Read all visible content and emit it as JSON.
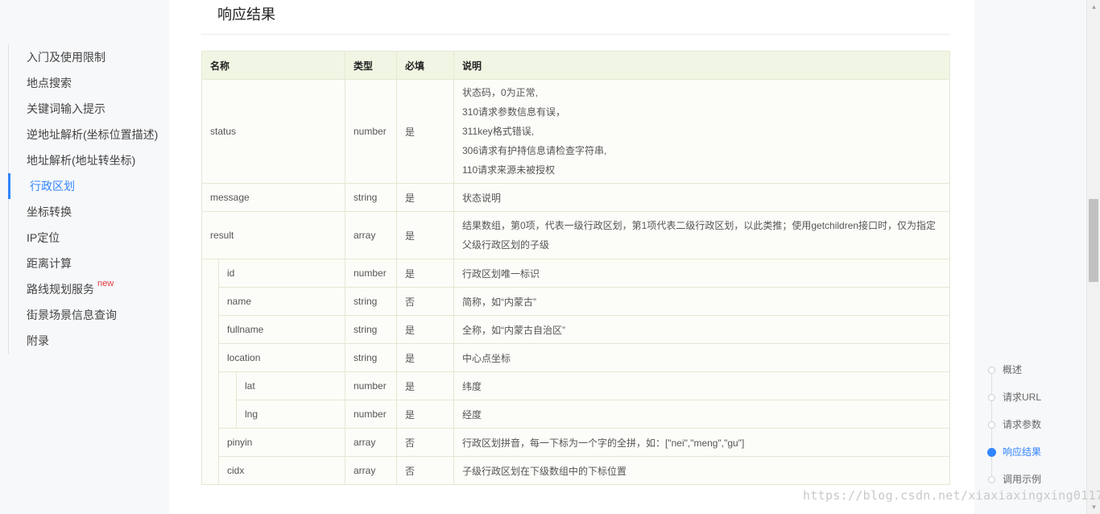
{
  "sidebar": {
    "items": [
      {
        "label": "入门及使用限制"
      },
      {
        "label": "地点搜索"
      },
      {
        "label": "关键词输入提示"
      },
      {
        "label": "逆地址解析(坐标位置描述)"
      },
      {
        "label": "地址解析(地址转坐标)"
      },
      {
        "label": "行政区划",
        "active": true
      },
      {
        "label": "坐标转换"
      },
      {
        "label": "IP定位"
      },
      {
        "label": "距离计算"
      },
      {
        "label": "路线规划服务",
        "badge": "new"
      },
      {
        "label": "街景场景信息查询"
      },
      {
        "label": "附录"
      }
    ]
  },
  "main": {
    "section_title": "响应结果",
    "table": {
      "headers": [
        "名称",
        "类型",
        "必填",
        "说明"
      ],
      "rows": [
        {
          "name": "status",
          "type": "number",
          "required": "是",
          "desc_lines": [
            "状态码，0为正常,",
            "310请求参数信息有误，",
            "311key格式错误,",
            "306请求有护持信息请检查字符串,",
            "110请求来源未被授权"
          ]
        },
        {
          "name": "message",
          "type": "string",
          "required": "是",
          "desc": "状态说明"
        },
        {
          "name": "result",
          "type": "array",
          "required": "是",
          "desc": "结果数组，第0项，代表一级行政区划，第1项代表二级行政区划，以此类推；使用getchildren接口时，仅为指定父级行政区划的子级"
        },
        {
          "name": "id",
          "type": "number",
          "required": "是",
          "desc": "行政区划唯一标识"
        },
        {
          "name": "name",
          "type": "string",
          "required": "否",
          "desc": "简称，如“内蒙古”"
        },
        {
          "name": "fullname",
          "type": "string",
          "required": "是",
          "desc": "全称，如“内蒙古自治区”"
        },
        {
          "name": "location",
          "type": "string",
          "required": "是",
          "desc": "中心点坐标"
        },
        {
          "name": "lat",
          "type": "number",
          "required": "是",
          "desc": "纬度"
        },
        {
          "name": "lng",
          "type": "number",
          "required": "是",
          "desc": "经度"
        },
        {
          "name": "pinyin",
          "type": "array",
          "required": "否",
          "desc": "行政区划拼音，每一下标为一个字的全拼，如：[\"nei\",\"meng\",\"gu\"]"
        },
        {
          "name": "cidx",
          "type": "array",
          "required": "否",
          "desc": "子级行政区划在下级数组中的下标位置"
        }
      ]
    }
  },
  "toc": {
    "items": [
      {
        "label": "概述"
      },
      {
        "label": "请求URL"
      },
      {
        "label": "请求参数"
      },
      {
        "label": "响应结果",
        "active": true
      },
      {
        "label": "调用示例"
      }
    ]
  },
  "watermark": "https://blog.csdn.net/xiaxiaxingxing0117",
  "colors": {
    "accent": "#3385ff",
    "table_header_bg": "#f1f6e4",
    "table_border": "#e4e8d4",
    "new_badge": "#e4393c"
  }
}
